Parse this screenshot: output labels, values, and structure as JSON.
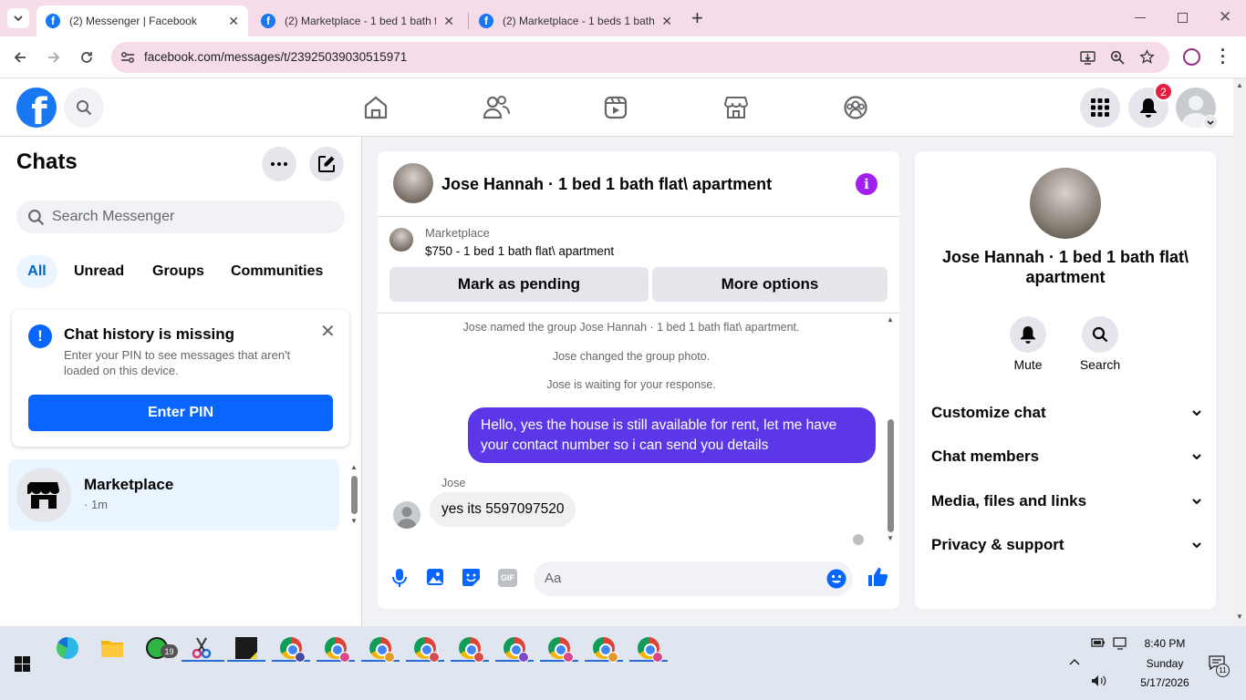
{
  "browser": {
    "tabs": [
      {
        "title": "(2) Messenger | Facebook",
        "active": true
      },
      {
        "title": "(2) Marketplace - 1 bed 1 bath f",
        "active": false
      },
      {
        "title": "(2) Marketplace - 1 beds 1 bath",
        "active": false
      }
    ],
    "new_tab": "+",
    "url": "facebook.com/messages/t/23925039030515971"
  },
  "fb_nav": {
    "logo_letter": "f",
    "notification_count": "2"
  },
  "left": {
    "title": "Chats",
    "search_placeholder": "Search Messenger",
    "filters": [
      "All",
      "Unread",
      "Groups",
      "Communities"
    ],
    "history_card": {
      "title": "Chat history is missing",
      "body": "Enter your PIN to see messages that aren't loaded on this device.",
      "button": "Enter PIN"
    },
    "chat_items": [
      {
        "name": "Marketplace",
        "meta": "· 1m"
      }
    ]
  },
  "chat": {
    "title": "Jose Hannah · 1 bed 1 bath flat\\ apartment",
    "listing": {
      "source": "Marketplace",
      "price_title": "$750 - 1 bed 1 bath flat\\ apartment",
      "pending_button": "Mark as pending",
      "more_button": "More options"
    },
    "system_messages": [
      "Jose named the group Jose Hannah · 1 bed 1 bath flat\\ apartment.",
      "Jose changed the group photo.",
      "Jose is waiting for your response."
    ],
    "outgoing": "Hello, yes the house is still available for rent, let me have your contact number so i can send you details",
    "incoming_sender": "Jose",
    "incoming": "yes its 5597097520",
    "composer_placeholder": "Aa",
    "gif_label": "GIF"
  },
  "info": {
    "name": "Jose Hannah · 1 bed 1 bath flat\\ apartment",
    "actions": [
      "Mute",
      "Search"
    ],
    "sections": [
      "Customize chat",
      "Chat members",
      "Media, files and links",
      "Privacy & support"
    ]
  },
  "taskbar": {
    "whatsapp_badge": "19",
    "time": "8:40 PM",
    "day": "Sunday",
    "date": "5/17/2026",
    "notif_count": "11"
  },
  "colors": {
    "fb_blue": "#1877f2",
    "outgoing_bubble": "#5b37e8",
    "accent_icon": "#0866ff",
    "info_icon": "#a020f0"
  }
}
